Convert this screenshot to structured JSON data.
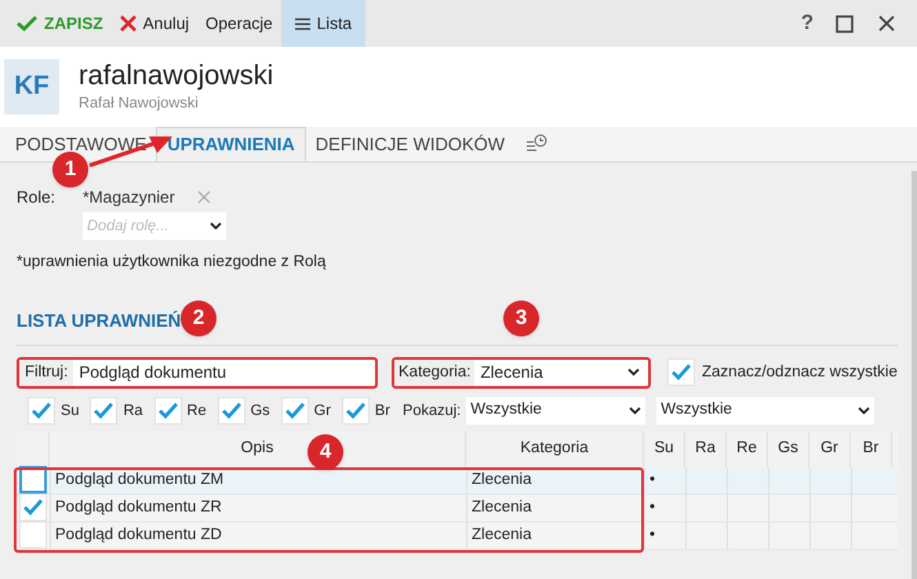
{
  "toolbar": [
    {
      "kind": "save",
      "label": "ZAPISZ",
      "selected": false
    },
    {
      "kind": "cancel",
      "label": "Anuluj",
      "selected": false
    },
    {
      "kind": "plain",
      "label": "Operacje",
      "selected": false
    },
    {
      "kind": "list",
      "label": "Lista",
      "selected": true
    }
  ],
  "window_controls": {
    "help": "?"
  },
  "header": {
    "avatar": "KF",
    "username": "rafalnawojowski",
    "full_name": "Rafał Nawojowski"
  },
  "tabs": [
    {
      "label": "PODSTAWOWE",
      "selected": false
    },
    {
      "label": "UPRAWNIENIA",
      "selected": true
    },
    {
      "label": "DEFINICJE WIDOKÓW",
      "selected": false
    }
  ],
  "roles": {
    "label": "Role:",
    "tags": [
      "*Magazynier"
    ],
    "add_placeholder": "Dodaj rolę...",
    "note": "*uprawnienia użytkownika niezgodne z Rolą"
  },
  "permissions": {
    "title": "LISTA UPRAWNIEŃ",
    "filter": {
      "label": "Filtruj:",
      "value": "Podgląd dokumentu"
    },
    "category": {
      "label": "Kategoria:",
      "value": "Zlecenia"
    },
    "select_all": {
      "label": "Zaznacz/odznacz wszystkie",
      "checked": true
    },
    "flags": [
      {
        "label": "Su",
        "checked": true
      },
      {
        "label": "Ra",
        "checked": true
      },
      {
        "label": "Re",
        "checked": true
      },
      {
        "label": "Gs",
        "checked": true
      },
      {
        "label": "Gr",
        "checked": true
      },
      {
        "label": "Br",
        "checked": true
      }
    ],
    "show": {
      "label": "Pokazuj:",
      "values": [
        "Wszystkie",
        "Wszystkie"
      ]
    },
    "table": {
      "columns": [
        "Opis",
        "Kategoria",
        "Su",
        "Ra",
        "Re",
        "Gs",
        "Gr",
        "Br"
      ],
      "rows": [
        {
          "checked": false,
          "selected": true,
          "cells": [
            "Podgląd dokumentu ZM",
            "Zlecenia",
            "•",
            "",
            "",
            "",
            "",
            ""
          ]
        },
        {
          "checked": true,
          "selected": false,
          "cells": [
            "Podgląd dokumentu ZR",
            "Zlecenia",
            "•",
            "",
            "",
            "",
            "",
            ""
          ]
        },
        {
          "checked": false,
          "selected": false,
          "cells": [
            "Podgląd dokumentu ZD",
            "Zlecenia",
            "•",
            "",
            "",
            "",
            "",
            ""
          ]
        }
      ]
    }
  },
  "annotations": [
    "1",
    "2",
    "3",
    "4"
  ]
}
